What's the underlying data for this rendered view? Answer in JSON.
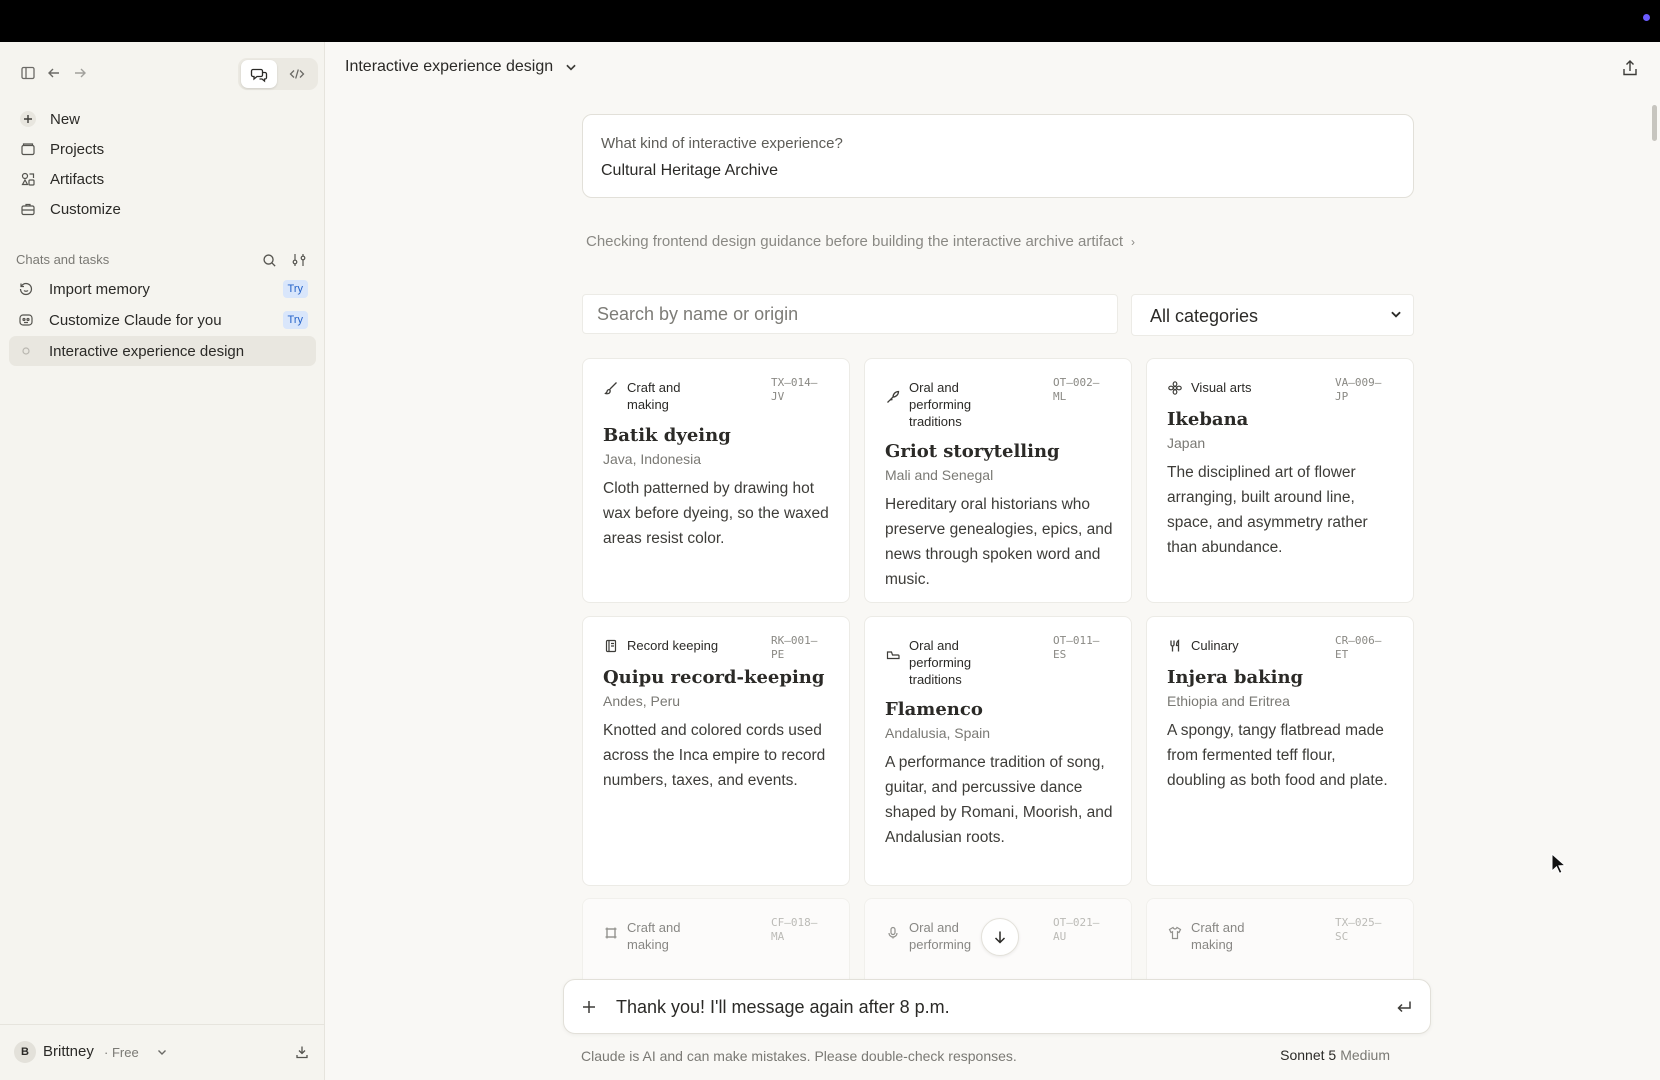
{
  "sidebar": {
    "nav": [
      {
        "label": "New",
        "icon": "plus-icon"
      },
      {
        "label": "Projects",
        "icon": "folder-icon"
      },
      {
        "label": "Artifacts",
        "icon": "artifacts-icon"
      },
      {
        "label": "Customize",
        "icon": "briefcase-icon"
      }
    ],
    "section_title": "Chats and tasks",
    "chats": [
      {
        "label": "Import memory",
        "badge": "Try",
        "icon": "memory-icon"
      },
      {
        "label": "Customize Claude for you",
        "badge": "Try",
        "icon": "customize-icon"
      },
      {
        "label": "Interactive experience design",
        "badge": "",
        "icon": "chat-dot-icon"
      }
    ],
    "user": {
      "initial": "B",
      "name": "Brittney",
      "plan": "· Free"
    }
  },
  "header": {
    "title": "Interactive experience design"
  },
  "prompt": {
    "question": "What kind of interactive experience?",
    "answer": "Cultural Heritage Archive"
  },
  "thinking": "Checking frontend design guidance before building the interactive archive artifact",
  "filters": {
    "search_placeholder": "Search by name or origin",
    "category_selected": "All categories"
  },
  "cards": [
    {
      "category": "Craft and making",
      "code": "TX–014–JV",
      "title": "Batik dyeing",
      "origin": "Java, Indonesia",
      "description": "Cloth patterned by drawing hot wax before dyeing, so the waxed areas resist color.",
      "icon": "brush-icon"
    },
    {
      "category": "Oral and performing traditions",
      "code": "OT–002–ML",
      "title": "Griot storytelling",
      "origin": "Mali and Senegal",
      "description": "Hereditary oral historians who preserve genealogies, epics, and news through spoken word and music.",
      "icon": "quill-icon"
    },
    {
      "category": "Visual arts",
      "code": "VA–009–JP",
      "title": "Ikebana",
      "origin": "Japan",
      "description": "The disciplined art of flower arranging, built around line, space, and asymmetry rather than abundance.",
      "icon": "flower-icon"
    },
    {
      "category": "Record keeping",
      "code": "RK–001–PE",
      "title": "Quipu record-keeping",
      "origin": "Andes, Peru",
      "description": "Knotted and colored cords used across the Inca empire to record numbers, taxes, and events.",
      "icon": "ledger-icon"
    },
    {
      "category": "Oral and performing traditions",
      "code": "OT–011–ES",
      "title": "Flamenco",
      "origin": "Andalusia, Spain",
      "description": "A performance tradition of song, guitar, and percussive dance shaped by Romani, Moorish, and Andalusian roots.",
      "icon": "shoe-icon"
    },
    {
      "category": "Culinary",
      "code": "CR–006–ET",
      "title": "Injera baking",
      "origin": "Ethiopia and Eritrea",
      "description": "A spongy, tangy flatbread made from fermented teff flour, doubling as both food and plate.",
      "icon": "utensils-icon"
    },
    {
      "category": "Craft and making",
      "code": "CF–018–MA",
      "icon": "frame-icon"
    },
    {
      "category": "Oral and performing",
      "code": "OT–021–AU",
      "icon": "mic-icon"
    },
    {
      "category": "Craft and making",
      "code": "TX–025–SC",
      "icon": "shirt-icon"
    }
  ],
  "composer": {
    "text": "Thank you! I'll message again after 8 p.m."
  },
  "footer": {
    "disclaimer": "Claude is AI and can make mistakes. Please double-check responses.",
    "model": "Sonnet 5",
    "effort": "Medium"
  }
}
